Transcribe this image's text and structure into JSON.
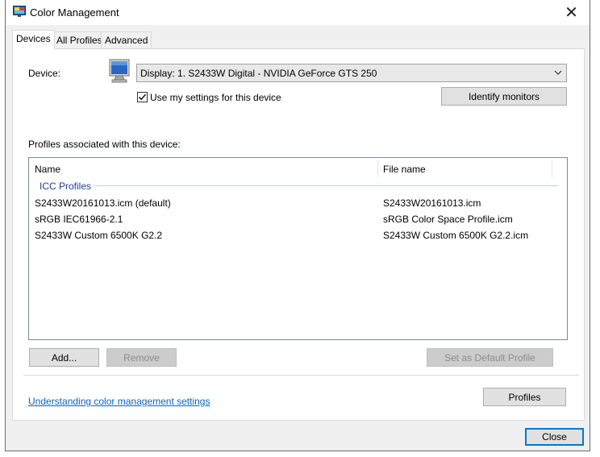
{
  "window": {
    "title": "Color Management",
    "title_icon": "color-management-icon",
    "close_glyph": "✕"
  },
  "tabs": [
    {
      "label": "Devices",
      "active": true
    },
    {
      "label": "All Profiles",
      "active": false
    },
    {
      "label": "Advanced",
      "active": false
    }
  ],
  "device": {
    "label": "Device:",
    "selected": "Display: 1. S2433W Digital - NVIDIA GeForce GTS 250",
    "use_my_settings_label": "Use my settings for this device",
    "use_my_settings_checked": true,
    "identify_button": "Identify monitors"
  },
  "profiles": {
    "section_label": "Profiles associated with this device:",
    "columns": [
      "Name",
      "File name"
    ],
    "group": "ICC Profiles",
    "rows": [
      {
        "name": "S2433W20161013.icm (default)",
        "file": "S2433W20161013.icm"
      },
      {
        "name": "sRGB IEC61966-2.1",
        "file": "sRGB Color Space Profile.icm"
      },
      {
        "name": "S2433W Custom 6500K G2.2",
        "file": "S2433W Custom 6500K G2.2.icm"
      }
    ]
  },
  "buttons": {
    "add": "Add...",
    "remove": "Remove",
    "set_default": "Set as Default Profile",
    "profiles": "Profiles",
    "close": "Close"
  },
  "help_link": "Understanding color management settings",
  "colors": {
    "link": "#0066cc",
    "group": "#1e3f9a",
    "accent": "#0078d7"
  }
}
